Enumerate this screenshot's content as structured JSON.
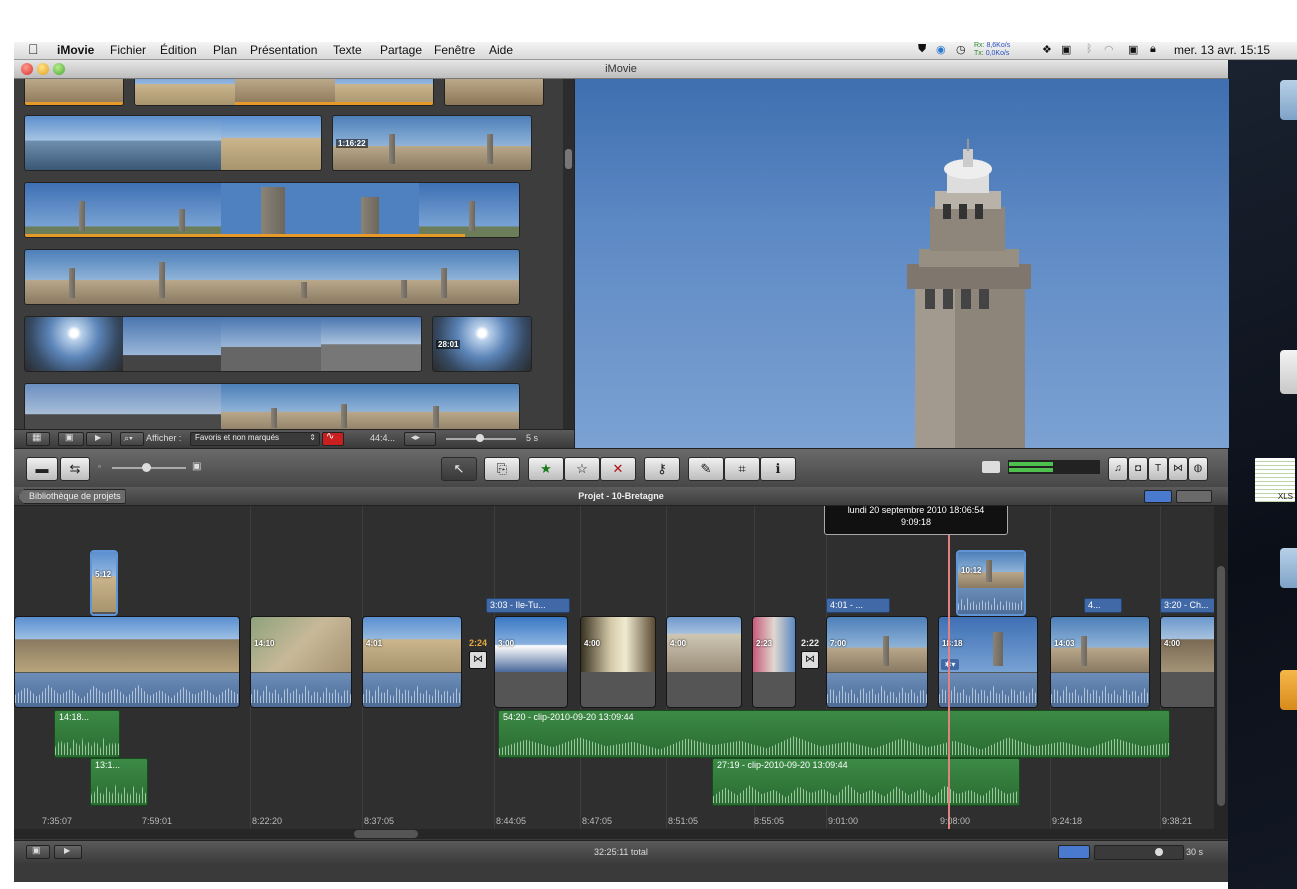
{
  "menubar": {
    "apple": "",
    "app": "iMovie",
    "items": [
      "Fichier",
      "Édition",
      "Plan",
      "Présentation",
      "Texte",
      "Partage",
      "Fenêtre",
      "Aide"
    ],
    "net_rx_label": "Rx:",
    "net_rx": "8,6Ko/s",
    "net_tx_label": "Tx:",
    "net_tx": "0,0Ko/s",
    "clock": "mer. 13 avr.  15:15"
  },
  "window": {
    "title": "iMovie"
  },
  "browser": {
    "clip_times": [
      "1:16:22",
      "28:01"
    ],
    "toolbar": {
      "show_label": "Afficher :",
      "filter": "Favoris et non marqués",
      "duration": "44:4...",
      "zoom_value": "5 s"
    }
  },
  "toolbar": {
    "select": "↖",
    "star": "★",
    "unstar": "☆",
    "reject": "✕",
    "keyword": "⚷",
    "dropper": "✎",
    "crop": "⌗",
    "info": "ℹ"
  },
  "project": {
    "library_button": "Bibliothèque de projets",
    "title": "Projet - 10-Bretagne"
  },
  "timeline": {
    "tooltip_date": "lundi 20 septembre 2010 18:06:54",
    "tooltip_time": "9:09:18",
    "clips": [
      {
        "time": "5:12"
      },
      {
        "time": "14:10"
      },
      {
        "time": "4:01"
      },
      {
        "time": "3:00"
      },
      {
        "time": "4:00"
      },
      {
        "time": "4:00"
      },
      {
        "time": "2:23"
      },
      {
        "time": "7:00"
      },
      {
        "time": "18:18"
      },
      {
        "time": "14:03"
      },
      {
        "time": "4:00"
      },
      {
        "time": "10:12"
      }
    ],
    "titles": [
      "3:03 - Ile-Tu...",
      "4:01 - ...",
      "4...",
      "3:20 - Ch..."
    ],
    "transitions": [
      {
        "time": "2:24"
      },
      {
        "time": "2:22"
      }
    ],
    "music": [
      {
        "label": "14:18..."
      },
      {
        "label": "13:1..."
      },
      {
        "label": "54:20 - clip-2010-09-20 13:09:44"
      },
      {
        "label": "27:19 - clip-2010-09-20 13:09:44"
      }
    ],
    "ruler": [
      "7:35:07",
      "7:59:01",
      "8:22:20",
      "8:37:05",
      "8:44:05",
      "8:47:05",
      "8:51:05",
      "8:55:05",
      "9:01:00",
      "9:08:00",
      "9:24:18",
      "9:38:21"
    ]
  },
  "status": {
    "total": "32:25:11 total",
    "zoom": "30 s"
  },
  "desktop": {
    "xls_label": "XLS"
  }
}
